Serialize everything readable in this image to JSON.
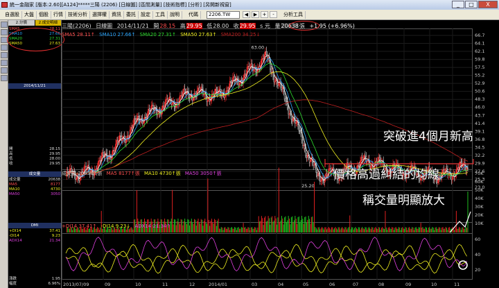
{
  "window": {
    "title": "統一金融家 [版本:2.60][A124]*****三陽 (2206) [日線圖] [區間測量] [技術指標] [分析] [另開新視窗]",
    "controls": [
      "_",
      "□",
      "X"
    ]
  },
  "toolbar": {
    "menus": [
      "自選股",
      "大盤",
      "個股",
      "行情",
      "技術分析",
      "選擇權",
      "資訊",
      "委託",
      "設定",
      "工具",
      "說明"
    ],
    "code_label": "代碼",
    "code_value": "2206.TW",
    "tool_icons": [
      "◀",
      "▶",
      "+",
      "-"
    ],
    "analysis_label": "分析工具"
  },
  "left_panel": {
    "tabs": [
      "2.分價",
      "2.成交明細"
    ],
    "ma_rows": [
      {
        "label": "SMA5",
        "value": "28.11"
      },
      {
        "label": "SMA10",
        "value": "27.66"
      },
      {
        "label": "SMA20",
        "value": "27.31"
      },
      {
        "label": "SMA50",
        "value": "27.63"
      }
    ],
    "date_label": "2014/11/21",
    "quote_rows": [
      {
        "label": "開",
        "value": "28.15"
      },
      {
        "label": "高",
        "value": "29.95"
      },
      {
        "label": "低",
        "value": "28.00"
      },
      {
        "label": "收",
        "value": "29.95"
      }
    ],
    "volume_tab": "成交量",
    "volume_rows": [
      {
        "label": "成交量",
        "value": "20638"
      },
      {
        "label": "MA5",
        "value": "8177"
      },
      {
        "label": "MA10",
        "value": "4730"
      },
      {
        "label": "MA50",
        "value": "3050"
      }
    ],
    "dmi_tab": "DMI",
    "dmi_rows": [
      {
        "label": "+DI14",
        "value": "37.41"
      },
      {
        "label": "-DI14",
        "value": "9.23"
      },
      {
        "label": "ADX14",
        "value": "21.34"
      }
    ],
    "footer_rows": [
      {
        "label": "漲跌",
        "value": "1.95"
      },
      {
        "label": "幅度",
        "value": "6.96%"
      }
    ]
  },
  "price_header": {
    "sma5": "SMA5 28.11↑",
    "sma10": "SMA10 27.66↑",
    "sma20": "SMA20 27.31↑",
    "sma50": "SMA50 27.63↑",
    "sma200": "SMA200 34.25↓"
  },
  "info_header": {
    "stock": "三陽(2206)",
    "period": "日線圖",
    "date": "2014/11/21",
    "open_label": "開",
    "open": "28.15",
    "high_label": "高",
    "high": "29.95",
    "low_label": "低",
    "low": "28.00",
    "close_label": "收",
    "close": "29.95",
    "unit": "s 元",
    "vol_label": "量",
    "vol": "20638",
    "vol_unit": "張",
    "change": "+1.95 (+6.96%)"
  },
  "volume_header": {
    "vol": "成交量 20638↑張",
    "ma5": "MA5 8177↑張",
    "ma10": "MA10 4730↑張",
    "ma50": "MA50 3050↑張"
  },
  "dmi_header": {
    "pdi": "+DI14 37.41↑",
    "mdi": "-DI14 9.23↓",
    "adx": "ADX14 21.34↑"
  },
  "price_axis": [
    "66.7",
    "64.1",
    "62.1",
    "59.8",
    "57.5",
    "55.2",
    "52.9",
    "50.6",
    "48.3",
    "46.0",
    "43.7",
    "41.4",
    "39.1",
    "36.8",
    "34.5",
    "32.2",
    "29.9",
    "27.6",
    "25.3",
    "23.0"
  ],
  "volume_axis": [
    "70K",
    "60K",
    "50K",
    "40K",
    "30K",
    "20K",
    "10K"
  ],
  "dmi_axis": [
    "60",
    "40",
    "20"
  ],
  "x_axis": [
    "2013/07/09",
    "09",
    "10",
    "11",
    "12",
    "2014/01",
    "03",
    "04",
    "05",
    "06",
    "07",
    "08",
    "09",
    "10",
    "11"
  ],
  "price_labels": {
    "peak": "63.00",
    "trough": "25.20"
  },
  "annotations": {
    "breakout": "突破進4個月新高",
    "above_ma": "價格高過糾結的均線",
    "volume": "稱交量明顯放大"
  },
  "colors": {
    "up": "#ff3030",
    "down": "#e8e8e8",
    "sma5": "#ffffff",
    "sma10": "#2aa7ff",
    "sma20": "#2ee02e",
    "sma50": "#f0f020",
    "sma200": "#c02020",
    "pdi": "#f0f020",
    "mdi": "#f0f020",
    "adx": "#e040e0",
    "axis": "#9a9a9a",
    "annotation_circle": "#e53030"
  },
  "chart_data": {
    "type": "candlestick",
    "title": "三陽(2206) 日線圖",
    "x_range": [
      "2013/07/09",
      "2014/11/21"
    ],
    "price_ylim": [
      23.0,
      66.7
    ],
    "volume_ylim": [
      0,
      70000
    ],
    "dmi_ylim": [
      0,
      60
    ],
    "monthly_close": [
      {
        "x": "2013/07",
        "close": 27.0
      },
      {
        "x": "2013/08",
        "close": 28.5
      },
      {
        "x": "2013/09",
        "close": 35.5
      },
      {
        "x": "2013/10",
        "close": 44.0
      },
      {
        "x": "2013/11",
        "close": 47.5
      },
      {
        "x": "2013/12",
        "close": 51.0
      },
      {
        "x": "2014/01",
        "close": 50.0
      },
      {
        "x": "2014/02",
        "close": 55.5
      },
      {
        "x": "2014/03",
        "close": 61.0
      },
      {
        "x": "2014/04",
        "close": 44.5
      },
      {
        "x": "2014/05",
        "close": 27.0
      },
      {
        "x": "2014/06",
        "close": 28.0
      },
      {
        "x": "2014/07",
        "close": 31.5
      },
      {
        "x": "2014/08",
        "close": 29.0
      },
      {
        "x": "2014/09",
        "close": 28.0
      },
      {
        "x": "2014/10",
        "close": 27.0
      },
      {
        "x": "2014/11",
        "close": 29.95
      }
    ],
    "peak": {
      "x": "2014/03",
      "value": 63.0
    },
    "trough": {
      "x": "2014/05",
      "value": 25.2
    },
    "last": {
      "open": 28.15,
      "high": 29.95,
      "low": 28.0,
      "close": 29.95,
      "volume": 20638
    },
    "sma": {
      "SMA5": 28.11,
      "SMA10": 27.66,
      "SMA20": 27.31,
      "SMA50": 27.63,
      "SMA200": 34.25
    },
    "volume_ma": {
      "MA5": 8177,
      "MA10": 4730,
      "MA50": 3050
    },
    "dmi": {
      "+DI14": 37.41,
      "-DI14": 9.23,
      "ADX14": 21.34
    },
    "grid": true
  }
}
